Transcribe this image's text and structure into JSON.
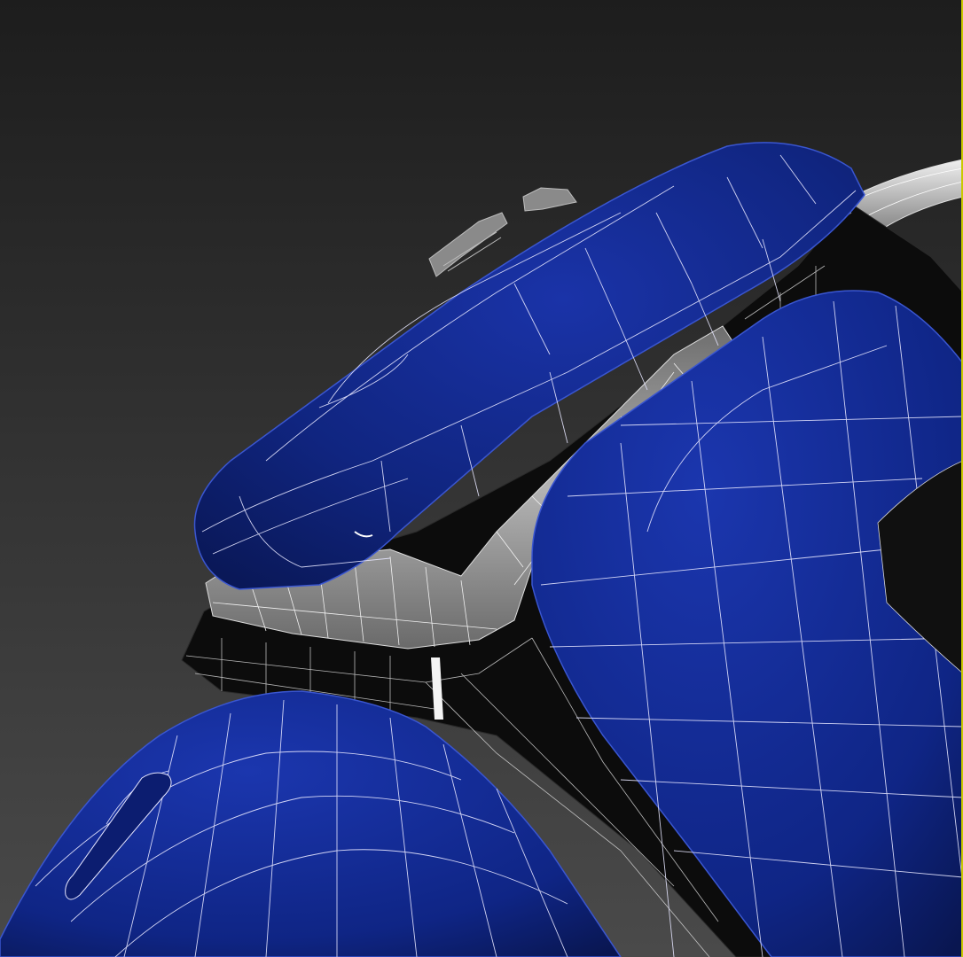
{
  "viewport": {
    "background_top": "#1d1d1d",
    "background_bottom": "#4a4a4a",
    "active_border_color": "#c8c800",
    "model": {
      "shell_color": "#0f2585",
      "shell_highlight": "#2a4bd0",
      "frame_color": "#0b0b0b",
      "lens_color": "#8c8c8c",
      "chrome_color": "#d0d0d0",
      "wire_color": "#ffffff"
    }
  }
}
